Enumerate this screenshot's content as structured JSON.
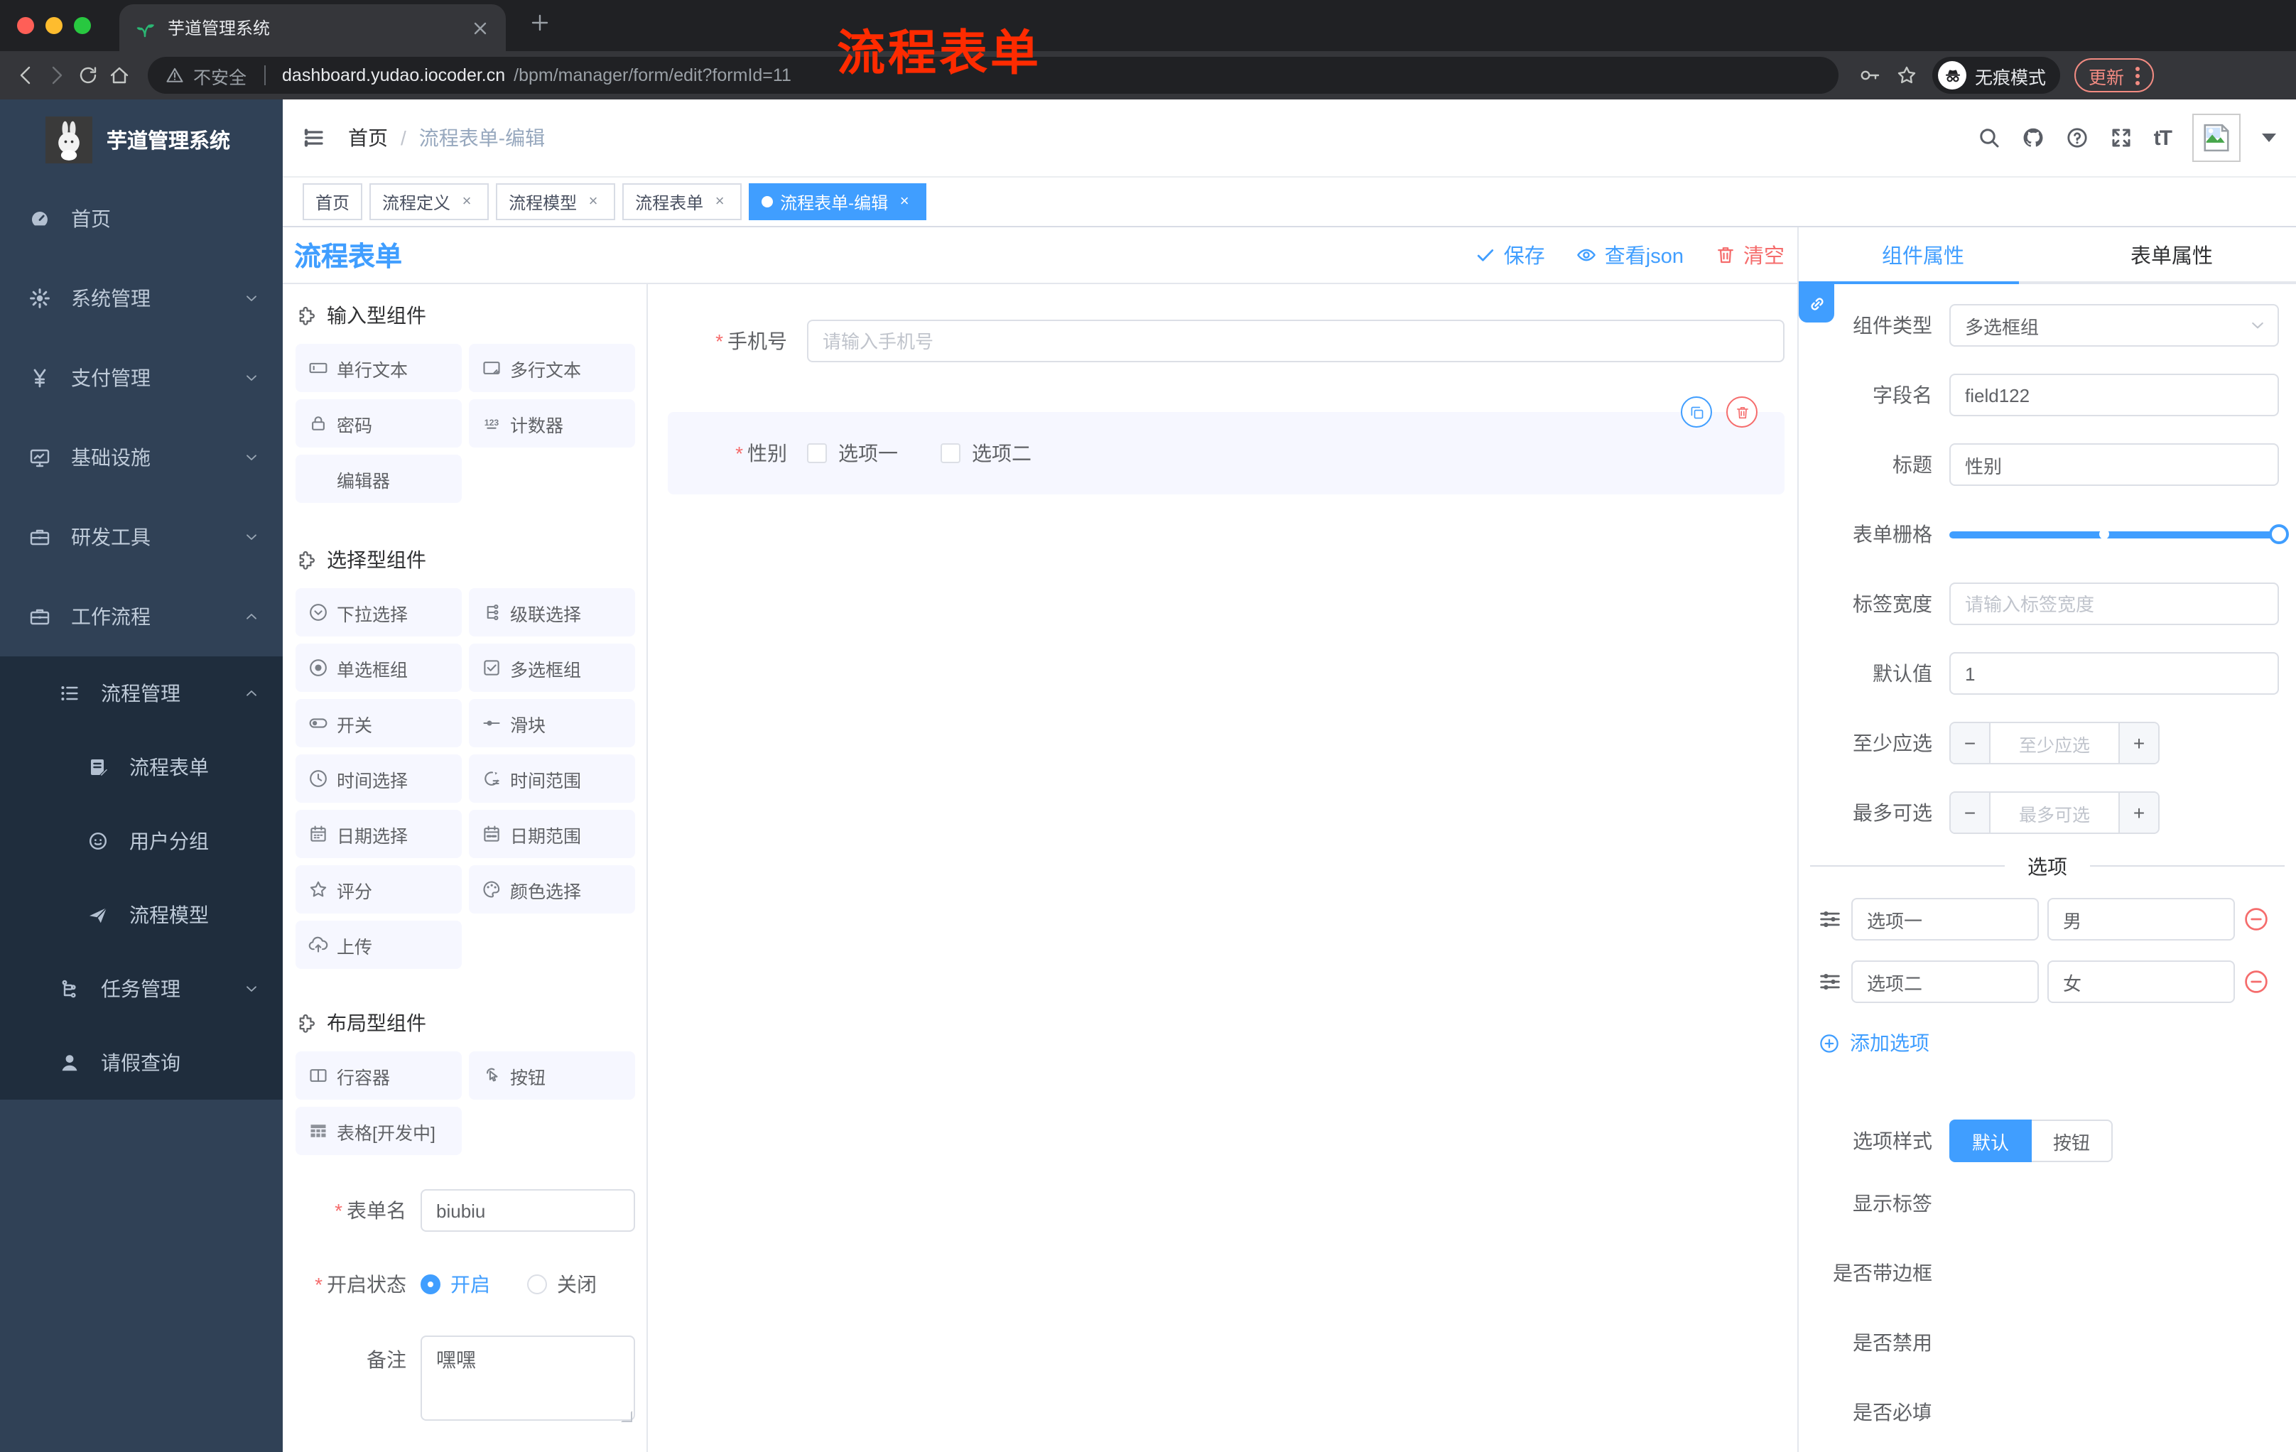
{
  "theme": {
    "accent": "#409eff",
    "danger": "#f56c6c",
    "sidebar_bg": "#304156",
    "sidebar_submenu_bg": "#1f2d3d",
    "chrome_bg": "#202124",
    "toolbar_bg": "#35363a",
    "annotation_red": "#fe2b00"
  },
  "misc": {
    "required_mark": "*",
    "plus": "+",
    "minus": "−",
    "close": "×",
    "font_icon": "tT"
  },
  "browser": {
    "tab_title": "芋道管理系统",
    "security_label": "不安全",
    "url_domain": "dashboard.yudao.iocoder.cn",
    "url_path": "/bpm/manager/form/edit?formId=11",
    "incognito_label": "无痕模式",
    "update_label": "更新"
  },
  "sidebar": {
    "brand": "芋道管理系统",
    "items": [
      {
        "label": "首页"
      },
      {
        "label": "系统管理"
      },
      {
        "label": "支付管理"
      },
      {
        "label": "基础设施"
      },
      {
        "label": "研发工具"
      },
      {
        "label": "工作流程"
      },
      {
        "label": "流程管理"
      },
      {
        "label": "流程表单"
      },
      {
        "label": "用户分组"
      },
      {
        "label": "流程模型"
      },
      {
        "label": "任务管理"
      },
      {
        "label": "请假查询"
      }
    ]
  },
  "navbar": {
    "breadcrumb": [
      "首页",
      "流程表单-编辑"
    ],
    "breadcrumb_sep": "/",
    "overlay_text": "流程表单"
  },
  "tags": [
    {
      "label": "首页",
      "closable": false,
      "active": false
    },
    {
      "label": "流程定义",
      "closable": true,
      "active": false
    },
    {
      "label": "流程模型",
      "closable": true,
      "active": false
    },
    {
      "label": "流程表单",
      "closable": true,
      "active": false
    },
    {
      "label": "流程表单-编辑",
      "closable": true,
      "active": true
    }
  ],
  "designer": {
    "title": "流程表单",
    "actions": {
      "save": "保存",
      "view_json": "查看json",
      "clear": "清空"
    },
    "groups": [
      {
        "title": "输入型组件",
        "items": [
          {
            "label": "单行文本"
          },
          {
            "label": "多行文本"
          },
          {
            "label": "密码"
          },
          {
            "label": "计数器"
          },
          {
            "label": "编辑器"
          }
        ]
      },
      {
        "title": "选择型组件",
        "items": [
          {
            "label": "下拉选择"
          },
          {
            "label": "级联选择"
          },
          {
            "label": "单选框组"
          },
          {
            "label": "多选框组"
          },
          {
            "label": "开关"
          },
          {
            "label": "滑块"
          },
          {
            "label": "时间选择"
          },
          {
            "label": "时间范围"
          },
          {
            "label": "日期选择"
          },
          {
            "label": "日期范围"
          },
          {
            "label": "评分"
          },
          {
            "label": "颜色选择"
          },
          {
            "label": "上传"
          }
        ]
      },
      {
        "title": "布局型组件",
        "items": [
          {
            "label": "行容器"
          },
          {
            "label": "按钮"
          },
          {
            "label": "表格[开发中]"
          }
        ]
      }
    ],
    "form_meta": {
      "name_label": "表单名",
      "name_value": "biubiu",
      "status_label": "开启状态",
      "status_on": "开启",
      "status_off": "关闭",
      "status_checked": "开启",
      "remark_label": "备注",
      "remark_value": "嘿嘿"
    },
    "canvas": {
      "phone": {
        "label": "手机号",
        "placeholder": "请输入手机号",
        "required": true
      },
      "gender": {
        "label": "性别",
        "required": true,
        "options": [
          "选项一",
          "选项二"
        ]
      }
    }
  },
  "properties": {
    "tabs": [
      "组件属性",
      "表单属性"
    ],
    "active_tab": "组件属性",
    "rows": {
      "component_type": {
        "label": "组件类型",
        "value": "多选框组"
      },
      "field_name": {
        "label": "字段名",
        "value": "field122"
      },
      "title_field": {
        "label": "标题",
        "value": "性别"
      },
      "grid": {
        "label": "表单栅格",
        "value": 24,
        "max": 24,
        "mark_at_percent": 47
      },
      "label_width": {
        "label": "标签宽度",
        "placeholder": "请输入标签宽度"
      },
      "default_value": {
        "label": "默认值",
        "value": "1"
      },
      "min_select": {
        "label": "至少应选",
        "placeholder": "至少应选"
      },
      "max_select": {
        "label": "最多可选",
        "placeholder": "最多可选"
      }
    },
    "options": {
      "divider": "选项",
      "rows": [
        {
          "label": "选项一",
          "value": "男"
        },
        {
          "label": "选项二",
          "value": "女"
        }
      ],
      "add_label": "添加选项"
    },
    "style": {
      "label": "选项样式",
      "options": [
        "默认",
        "按钮"
      ],
      "active": "默认"
    },
    "switches": [
      {
        "label": "显示标签",
        "on": true
      },
      {
        "label": "是否带边框",
        "on": false
      },
      {
        "label": "是否禁用",
        "on": false
      },
      {
        "label": "是否必填",
        "on": true
      }
    ]
  }
}
